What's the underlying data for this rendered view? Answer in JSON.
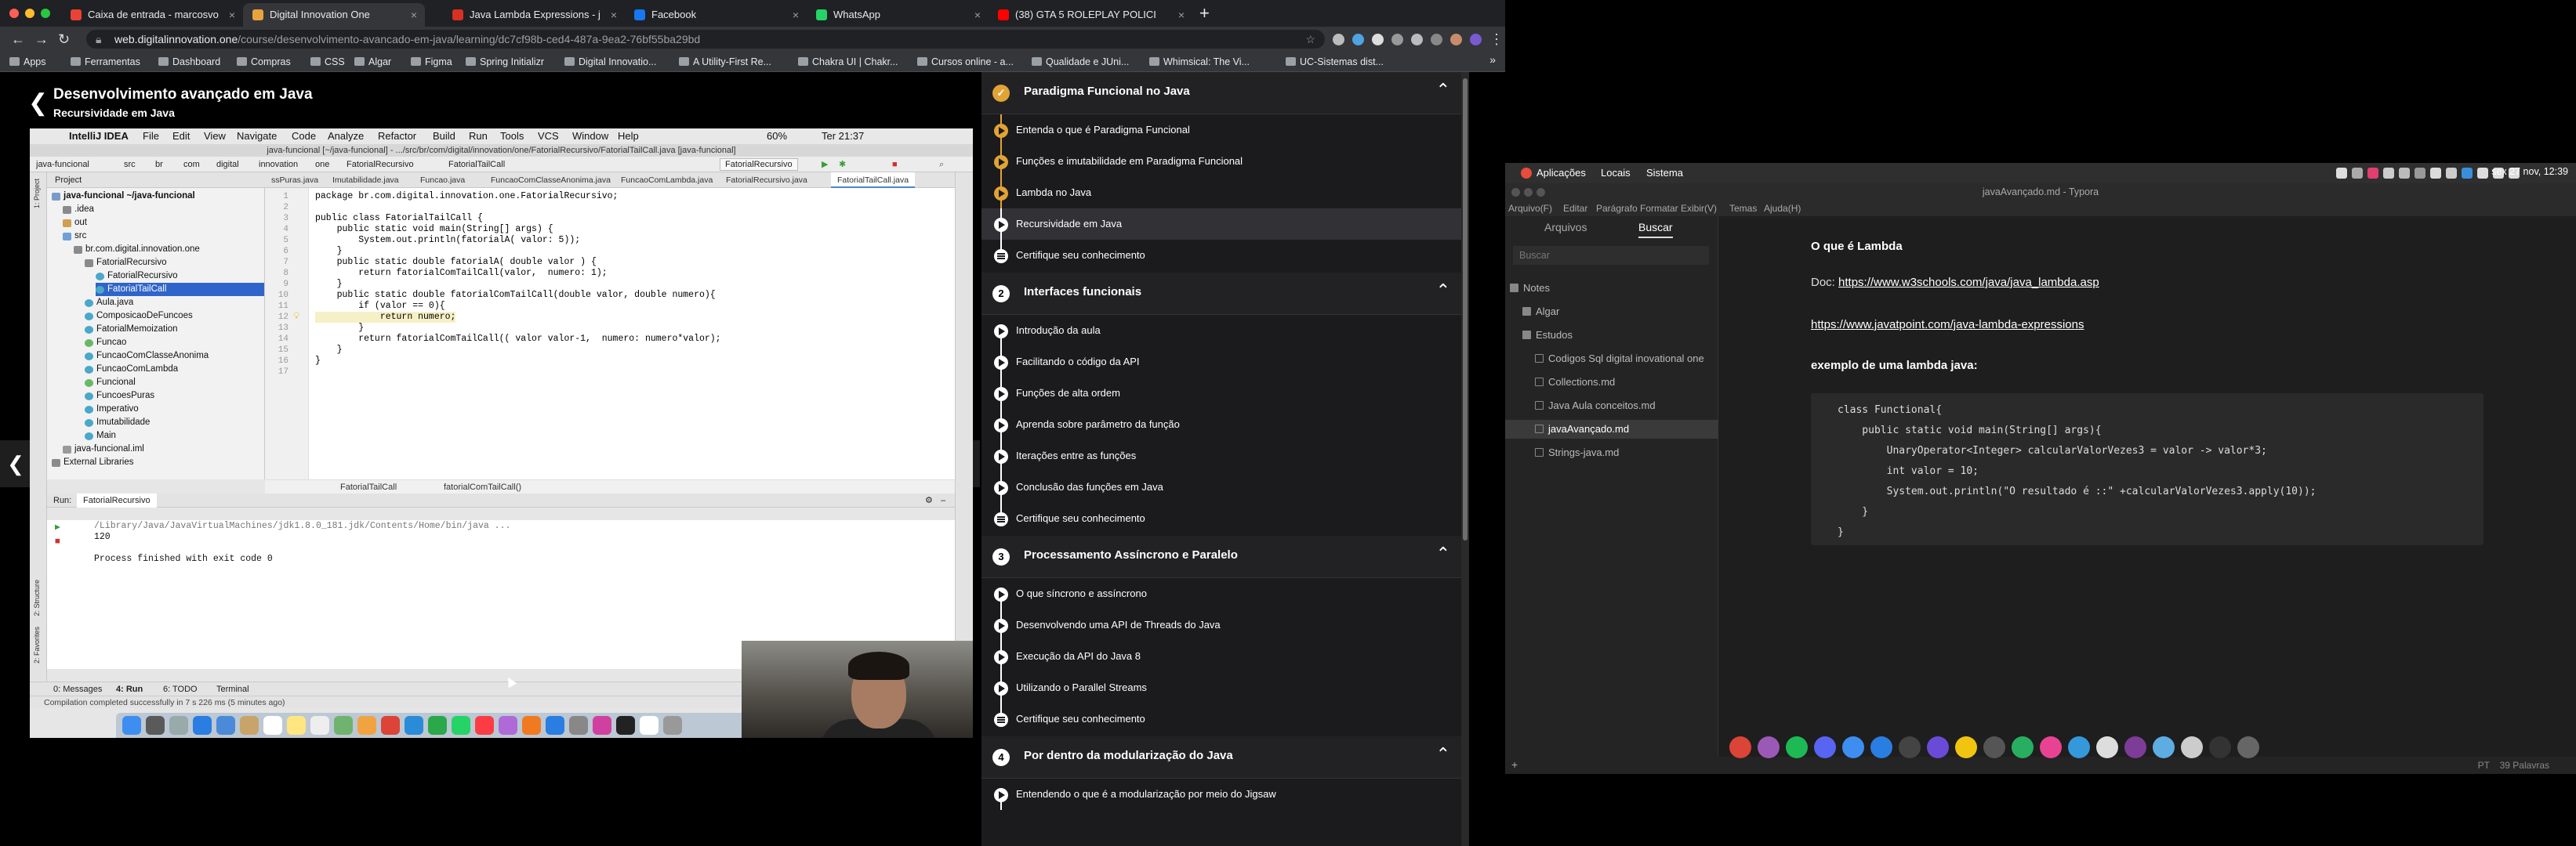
{
  "browser": {
    "tabs": [
      {
        "title": "Caixa de entrada - marcosvo",
        "color": "#ea4335"
      },
      {
        "title": "Digital Innovation One",
        "color": "#e8a33d"
      },
      {
        "title": "Java Lambda Expressions - j",
        "color": "#d93025"
      },
      {
        "title": "Facebook",
        "color": "#1877f2"
      },
      {
        "title": "WhatsApp",
        "color": "#25d366"
      },
      {
        "title": "(38) GTA 5 ROLEPLAY POLICI",
        "color": "#ff0000"
      }
    ],
    "url_host": "web.digitalinnovation.one",
    "url_path": "/course/desenvolvimento-avancado-em-java/learning/dc7cf98b-ced4-487a-9ea2-76bf55ba29bd",
    "bookmarks": [
      "Apps",
      "Ferramentas",
      "Dashboard",
      "Compras",
      "CSS",
      "Algar",
      "Figma",
      "Spring Initializr",
      "Digital Innovatio...",
      "A Utility-First Re...",
      "Chakra UI | Chakr...",
      "Cursos online - a...",
      "Qualidade e JUni...",
      "Whimsical: The Vi...",
      "UC-Sistemas dist..."
    ]
  },
  "course": {
    "title": "Desenvolvimento avançado em Java",
    "subtitle": "Recursividade em Java"
  },
  "ide": {
    "mac_menu": [
      "IntelliJ IDEA",
      "File",
      "Edit",
      "View",
      "Navigate",
      "Code",
      "Analyze",
      "Refactor",
      "Build",
      "Run",
      "Tools",
      "VCS",
      "Window",
      "Help"
    ],
    "battery": "60%",
    "clock": "Ter 21:37",
    "window_title": "java-funcional [~/java-funcional] - .../src/br/com/digital/innovation/one/FatorialRecursivo/FatorialTailCall.java [java-funcional]",
    "nav": [
      "java-funcional",
      "src",
      "br",
      "com",
      "digital",
      "innovation",
      "one",
      "FatorialRecursivo",
      "FatorialTailCall"
    ],
    "run_config": "FatorialRecursivo",
    "project_label": "Project",
    "editor_tabs": [
      "ssPuras.java",
      "Imutabilidade.java",
      "Funcao.java",
      "FuncaoComClasseAnonima.java",
      "FuncaoComLambda.java",
      "FatorialRecursivo.java",
      "FatorialTailCall.java"
    ],
    "tree": [
      {
        "label": "java-funcional ~/java-funcional"
      },
      {
        "label": ".idea"
      },
      {
        "label": "out"
      },
      {
        "label": "src"
      },
      {
        "label": "br.com.digital.innovation.one"
      },
      {
        "label": "FatorialRecursivo"
      },
      {
        "label": "FatorialRecursivo"
      },
      {
        "label": "FatorialTailCall"
      },
      {
        "label": "Aula.java"
      },
      {
        "label": "ComposicaoDeFuncoes"
      },
      {
        "label": "FatorialMemoization"
      },
      {
        "label": "Funcao"
      },
      {
        "label": "FuncaoComClasseAnonima"
      },
      {
        "label": "FuncaoComLambda"
      },
      {
        "label": "Funcional"
      },
      {
        "label": "FuncoesPuras"
      },
      {
        "label": "Imperativo"
      },
      {
        "label": "Imutabilidade"
      },
      {
        "label": "Main"
      },
      {
        "label": "java-funcional.iml"
      },
      {
        "label": "External Libraries"
      }
    ],
    "code": [
      "package br.com.digital.innovation.one.FatorialRecursivo;",
      "",
      "public class FatorialTailCall {",
      "    public static void main(String[] args) {",
      "        System.out.println(fatorialA( valor: 5));",
      "    }",
      "    public static double fatorialA( double valor ) {",
      "        return fatorialComTailCall(valor,  numero: 1);",
      "    }",
      "    public static double fatorialComTailCall(double valor, double numero){",
      "        if (valor == 0){",
      "            return numero;",
      "        }",
      "        return fatorialComTailCall(( valor valor-1,  numero: numero*valor);",
      "    }",
      "}",
      ""
    ],
    "breadcrumb": [
      "FatorialTailCall",
      "fatorialComTailCall()"
    ],
    "run_label": "Run:",
    "run_tab": "FatorialRecursivo",
    "output": [
      "/Library/Java/JavaVirtualMachines/jdk1.8.0_181.jdk/Contents/Home/bin/java ...",
      "120",
      "",
      "Process finished with exit code 0"
    ],
    "bottom_tabs": [
      "0: Messages",
      "4: Run",
      "6: TODO",
      "Terminal"
    ],
    "status": "Compilation completed successfully in 7 s 226 ms (5 minutes ago)",
    "strip_labels": [
      "1: Project",
      "2: Structure",
      "2: Favorites"
    ]
  },
  "syllabus": [
    {
      "num": "",
      "title": "Paradigma Funcional no Java",
      "done": true,
      "lessons": [
        {
          "label": "Entenda o que é Paradigma Funcional",
          "state": "done",
          "kind": "video"
        },
        {
          "label": "Funções e imutabilidade em Paradigma Funcional",
          "state": "done",
          "kind": "video"
        },
        {
          "label": "Lambda no Java",
          "state": "done",
          "kind": "video"
        },
        {
          "label": "Recursividade em Java",
          "state": "current",
          "kind": "video"
        },
        {
          "label": "Certifique seu conhecimento",
          "state": "todo",
          "kind": "quiz"
        }
      ]
    },
    {
      "num": "2",
      "title": "Interfaces funcionais",
      "done": false,
      "lessons": [
        {
          "label": "Introdução da aula",
          "state": "todo",
          "kind": "video"
        },
        {
          "label": "Facilitando o código da API",
          "state": "todo",
          "kind": "video"
        },
        {
          "label": "Funções de alta ordem",
          "state": "todo",
          "kind": "video"
        },
        {
          "label": "Aprenda sobre parâmetro da função",
          "state": "todo",
          "kind": "video"
        },
        {
          "label": "Iterações entre as funções",
          "state": "todo",
          "kind": "video"
        },
        {
          "label": "Conclusão das funções em Java",
          "state": "todo",
          "kind": "video"
        },
        {
          "label": "Certifique seu conhecimento",
          "state": "todo",
          "kind": "quiz"
        }
      ]
    },
    {
      "num": "3",
      "title": "Processamento Assíncrono e Paralelo",
      "done": false,
      "lessons": [
        {
          "label": "O que síncrono e assíncrono",
          "state": "todo",
          "kind": "video"
        },
        {
          "label": "Desenvolvendo uma API de Threads do Java",
          "state": "todo",
          "kind": "video"
        },
        {
          "label": "Execução da API do Java 8",
          "state": "todo",
          "kind": "video"
        },
        {
          "label": "Utilizando o Parallel Streams",
          "state": "todo",
          "kind": "video"
        },
        {
          "label": "Certifique seu conhecimento",
          "state": "todo",
          "kind": "quiz"
        }
      ]
    },
    {
      "num": "4",
      "title": "Por dentro da modularização do Java",
      "done": false,
      "lessons": [
        {
          "label": "Entendendo o que é a modularização por meio do Jigsaw",
          "state": "todo",
          "kind": "video"
        }
      ]
    }
  ],
  "desktop": {
    "panel_menu": [
      "Aplicações",
      "Locais",
      "Sistema"
    ],
    "clock": "sex 27 nov, 12:39",
    "typora": {
      "title": "javaAvançado.md - Typora",
      "menu": [
        "Arquivo(F)",
        "Editar",
        "Parágrafo",
        "Formatar",
        "Exibir(V)",
        "Temas",
        "Ajuda(H)"
      ],
      "tabs": [
        "Arquivos",
        "Buscar"
      ],
      "search_placeholder": "Buscar",
      "files": [
        {
          "label": "Notes",
          "kind": "folder",
          "indent": 0
        },
        {
          "label": "Algar",
          "kind": "folder",
          "indent": 1
        },
        {
          "label": "Estudos",
          "kind": "folder",
          "indent": 1
        },
        {
          "label": "Codigos Sql digital inovational one",
          "kind": "file",
          "indent": 2
        },
        {
          "label": "Collections.md",
          "kind": "file",
          "indent": 2
        },
        {
          "label": "Java Aula conceitos.md",
          "kind": "file",
          "indent": 2
        },
        {
          "label": "javaAvançado.md",
          "kind": "file",
          "indent": 2
        },
        {
          "label": "Strings-java.md",
          "kind": "file",
          "indent": 2
        }
      ],
      "heading": "O que é Lambda",
      "doc_label": "Doc: ",
      "link1": "https://www.w3schools.com/java/java_lambda.asp",
      "link2": "https://www.javatpoint.com/java-lambda-expressions",
      "example_heading": "exemplo de uma lambda java:",
      "code": [
        "class Functional{",
        "    public static void main(String[] args){",
        "        UnaryOperator<Integer> calcularValorVezes3 = valor -> valor*3;",
        "        int valor = 10;",
        "        System.out.println(\"O resultado é ::\" +calcularValorVezes3.apply(10));",
        "    }",
        "}"
      ],
      "locale": "PT",
      "word_count": "39 Palavras"
    }
  }
}
